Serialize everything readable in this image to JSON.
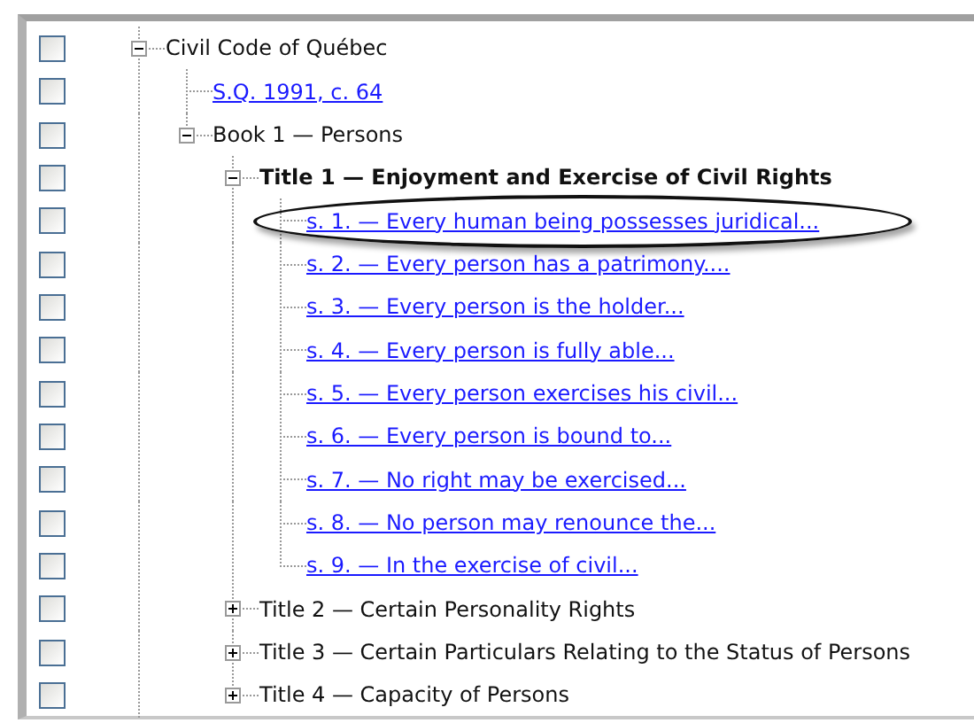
{
  "tree": [
    {
      "label": "Civil Code of Québec",
      "kind": "folder",
      "expanded": true,
      "bold": false,
      "checked": false,
      "circled": false,
      "children": [
        {
          "label": "S.Q. 1991, c. 64",
          "kind": "link",
          "bold": false,
          "checked": false,
          "circled": false
        },
        {
          "label": "Book 1 — Persons",
          "kind": "folder",
          "expanded": true,
          "bold": false,
          "checked": false,
          "circled": false,
          "children": [
            {
              "label": "Title 1 — Enjoyment and Exercise of Civil Rights",
              "kind": "folder",
              "expanded": true,
              "bold": true,
              "checked": false,
              "circled": false,
              "children": [
                {
                  "label": "s. 1. — Every human being possesses juridical...",
                  "kind": "link",
                  "bold": false,
                  "checked": false,
                  "circled": true
                },
                {
                  "label": "s. 2. — Every person has a patrimony....",
                  "kind": "link",
                  "bold": false,
                  "checked": false,
                  "circled": false
                },
                {
                  "label": "s. 3. — Every person is the holder...",
                  "kind": "link",
                  "bold": false,
                  "checked": false,
                  "circled": false
                },
                {
                  "label": "s. 4. — Every person is fully able...",
                  "kind": "link",
                  "bold": false,
                  "checked": false,
                  "circled": false
                },
                {
                  "label": "s. 5. — Every person exercises his civil...",
                  "kind": "link",
                  "bold": false,
                  "checked": false,
                  "circled": false
                },
                {
                  "label": "s. 6. — Every person is bound to...",
                  "kind": "link",
                  "bold": false,
                  "checked": false,
                  "circled": false
                },
                {
                  "label": "s. 7. — No right may be exercised...",
                  "kind": "link",
                  "bold": false,
                  "checked": false,
                  "circled": false
                },
                {
                  "label": "s. 8. — No person may renounce the...",
                  "kind": "link",
                  "bold": false,
                  "checked": false,
                  "circled": false
                },
                {
                  "label": "s. 9. — In the exercise of civil...",
                  "kind": "link",
                  "bold": false,
                  "checked": false,
                  "circled": false
                }
              ]
            },
            {
              "label": "Title 2 — Certain Personality Rights",
              "kind": "folder",
              "expanded": false,
              "bold": false,
              "checked": false,
              "circled": false
            },
            {
              "label": "Title 3 — Certain Particulars Relating to the Status of Persons",
              "kind": "folder",
              "expanded": false,
              "bold": false,
              "checked": false,
              "circled": false
            },
            {
              "label": "Title 4 — Capacity of Persons",
              "kind": "folder",
              "expanded": false,
              "bold": false,
              "checked": false,
              "circled": false
            }
          ]
        }
      ]
    }
  ]
}
